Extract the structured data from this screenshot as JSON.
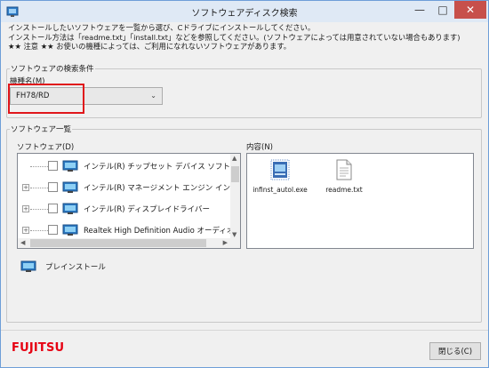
{
  "window": {
    "title": "ソフトウェアディスク検索",
    "minimize": "—",
    "maximize": "□",
    "close": "✕"
  },
  "instructions": [
    "インストールしたいソフトウェアを一覧から選び、Cドライブにインストールしてください。",
    "インストール方法は「readme.txt」「install.txt」などを参照してください。(ソフトウェアによっては用意されていない場合もあります)",
    "★★ 注意 ★★ お使いの機種によっては、ご利用になれないソフトウェアがあります。"
  ],
  "search": {
    "group_title": "ソフトウェアの検索条件",
    "model_label": "機種名(M)",
    "model_value": "FH78/RD"
  },
  "software_list": {
    "group_title": "ソフトウェア一覧",
    "tree_label": "ソフトウェア(D)",
    "content_label": "内容(N)",
    "items": [
      {
        "label": "インテル(R) チップセット デバイス ソフトウェア",
        "expandable": false
      },
      {
        "label": "インテル(R) マネージメント エンジン インターフェイ",
        "expandable": true
      },
      {
        "label": "インテル(R) ディスプレイドライバー",
        "expandable": true
      },
      {
        "label": "Realtek High Definition Audio オーディオドライバ",
        "expandable": true
      }
    ],
    "files": [
      {
        "name": "infinst_autol.exe",
        "icon": "exe-file-icon"
      },
      {
        "name": "readme.txt",
        "icon": "text-file-icon"
      }
    ],
    "legend": "プレインストール"
  },
  "footer": {
    "logo": "FUJITSU",
    "close_button": "閉じる(C)"
  },
  "colors": {
    "highlight": "#e0161b",
    "logo": "#e60012",
    "titlebar": "#dfe9f5"
  }
}
